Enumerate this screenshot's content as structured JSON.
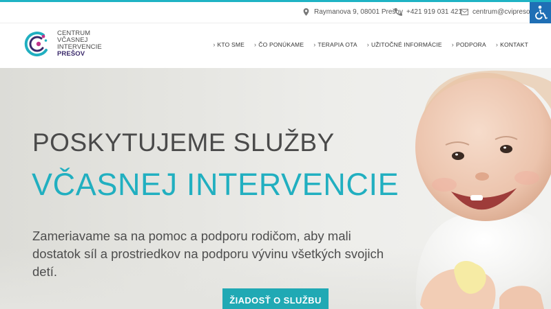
{
  "topbar": {
    "address": "Raymanova 9, 08001 Prešov",
    "phone": "+421 919 031 421",
    "email": "centrum@cvipresov.sk"
  },
  "logo": {
    "line1": "CENTRUM",
    "line2": "VČASNEJ",
    "line3": "INTERVENCIE",
    "city": "PREŠOV"
  },
  "nav": {
    "items": [
      {
        "label": "KTO SME"
      },
      {
        "label": "ČO PONÚKAME"
      },
      {
        "label": "TERAPIA OTA"
      },
      {
        "label": "UŽITOČNÉ INFORMÁCIE"
      },
      {
        "label": "PODPORA"
      },
      {
        "label": "KONTAKT"
      }
    ]
  },
  "hero": {
    "headline_line1": "POSKYTUJEME SLUŽBY",
    "headline_line2": "VČASNEJ INTERVENCIE",
    "subtext_line1": "Zameriavame sa na pomoc a podporu rodičom, aby mali",
    "subtext_line2": "dostatok síl a prostriedkov na podporu vývinu všetkých svojich detí.",
    "cta_label": "ŽIADOSŤ O SLUŽBU"
  },
  "colors": {
    "accent": "#21afc0",
    "button": "#20a9b4",
    "accessibility": "#1f6fb5",
    "logo_purple": "#3b2a6b"
  },
  "icons": [
    "map-marker-icon",
    "phone-icon",
    "envelope-icon",
    "wheelchair-icon",
    "chevron-right-icon"
  ]
}
